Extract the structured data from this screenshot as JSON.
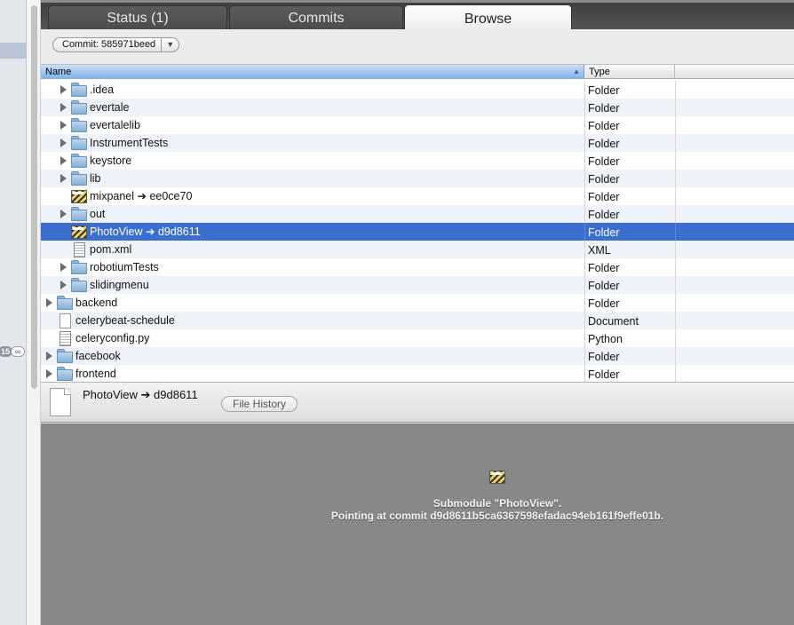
{
  "tabs": [
    {
      "label": "Status (1)",
      "active": false
    },
    {
      "label": "Commits",
      "active": false
    },
    {
      "label": "Browse",
      "active": true
    }
  ],
  "toolbar": {
    "commit_label": "Commit: 585971beed",
    "dropdown_icon": "triangle-down-icon"
  },
  "sidebar": {
    "badge": "15",
    "badge_symbol": "∞"
  },
  "table": {
    "columns": [
      "Name",
      "Type"
    ],
    "rows": [
      {
        "name": "▶ .idea",
        "label": ".idea",
        "type": "Folder",
        "icon": "folder",
        "indent": 1,
        "expandable": true
      },
      {
        "label": "evertale",
        "type": "Folder",
        "icon": "folder",
        "indent": 1,
        "expandable": true
      },
      {
        "label": "evertalelib",
        "type": "Folder",
        "icon": "folder",
        "indent": 1,
        "expandable": true
      },
      {
        "label": "InstrumentTests",
        "type": "Folder",
        "icon": "folder",
        "indent": 1,
        "expandable": true
      },
      {
        "label": "keystore",
        "type": "Folder",
        "icon": "folder",
        "indent": 1,
        "expandable": true
      },
      {
        "label": "lib",
        "type": "Folder",
        "icon": "folder",
        "indent": 1,
        "expandable": true
      },
      {
        "label": "mixpanel ➔ ee0ce70",
        "type": "Folder",
        "icon": "submodule",
        "indent": 1,
        "expandable": false
      },
      {
        "label": "out",
        "type": "Folder",
        "icon": "folder",
        "indent": 1,
        "expandable": true
      },
      {
        "label": "PhotoView ➔ d9d8611",
        "type": "Folder",
        "icon": "submodule",
        "indent": 1,
        "expandable": false,
        "selected": true
      },
      {
        "label": "pom.xml",
        "type": "XML",
        "icon": "code",
        "indent": 1,
        "expandable": false
      },
      {
        "label": "robotiumTests",
        "type": "Folder",
        "icon": "folder",
        "indent": 1,
        "expandable": true
      },
      {
        "label": "slidingmenu",
        "type": "Folder",
        "icon": "folder",
        "indent": 1,
        "expandable": true
      },
      {
        "label": "backend",
        "type": "Folder",
        "icon": "folder",
        "indent": 0,
        "expandable": true
      },
      {
        "label": "celerybeat-schedule",
        "type": "Document",
        "icon": "doc",
        "indent": 0,
        "expandable": false
      },
      {
        "label": "celeryconfig.py",
        "type": "Python",
        "icon": "code",
        "indent": 0,
        "expandable": false
      },
      {
        "label": "facebook",
        "type": "Folder",
        "icon": "folder",
        "indent": 0,
        "expandable": true
      },
      {
        "label": "frontend",
        "type": "Folder",
        "icon": "folder",
        "indent": 0,
        "expandable": true
      }
    ]
  },
  "info": {
    "name": "PhotoView ➔ d9d8611",
    "file_history_label": "File History"
  },
  "preview": {
    "line1": "Submodule \"PhotoView\".",
    "line2": "Pointing at commit d9d8611b5ca6367598efadac94eb161f9effe01b."
  },
  "colors": {
    "selection": "#3a6fd0",
    "header_blue": "#7fb0e8"
  }
}
